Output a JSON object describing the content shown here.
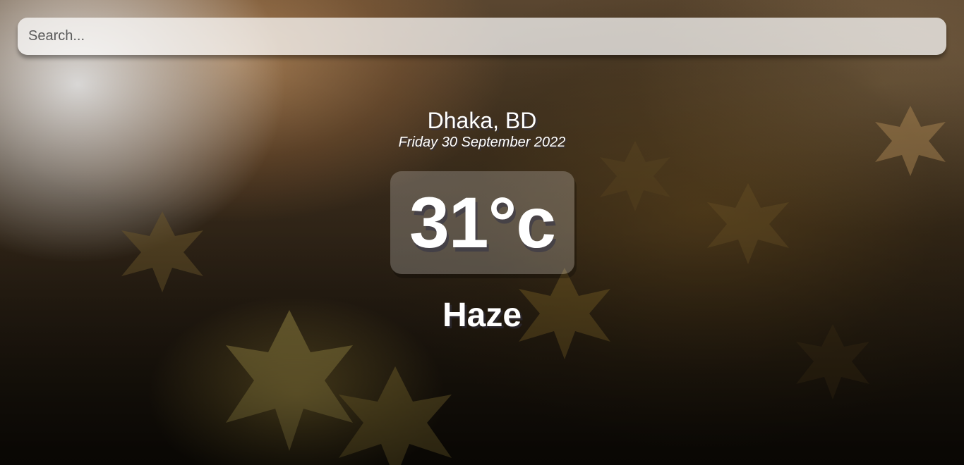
{
  "search": {
    "placeholder": "Search..."
  },
  "location": {
    "city": "Dhaka, BD",
    "date": "Friday 30 September 2022"
  },
  "weather": {
    "temperature": "31°c",
    "condition": "Haze"
  },
  "background": {
    "description_icon": "autumn-leaves-background-image"
  }
}
